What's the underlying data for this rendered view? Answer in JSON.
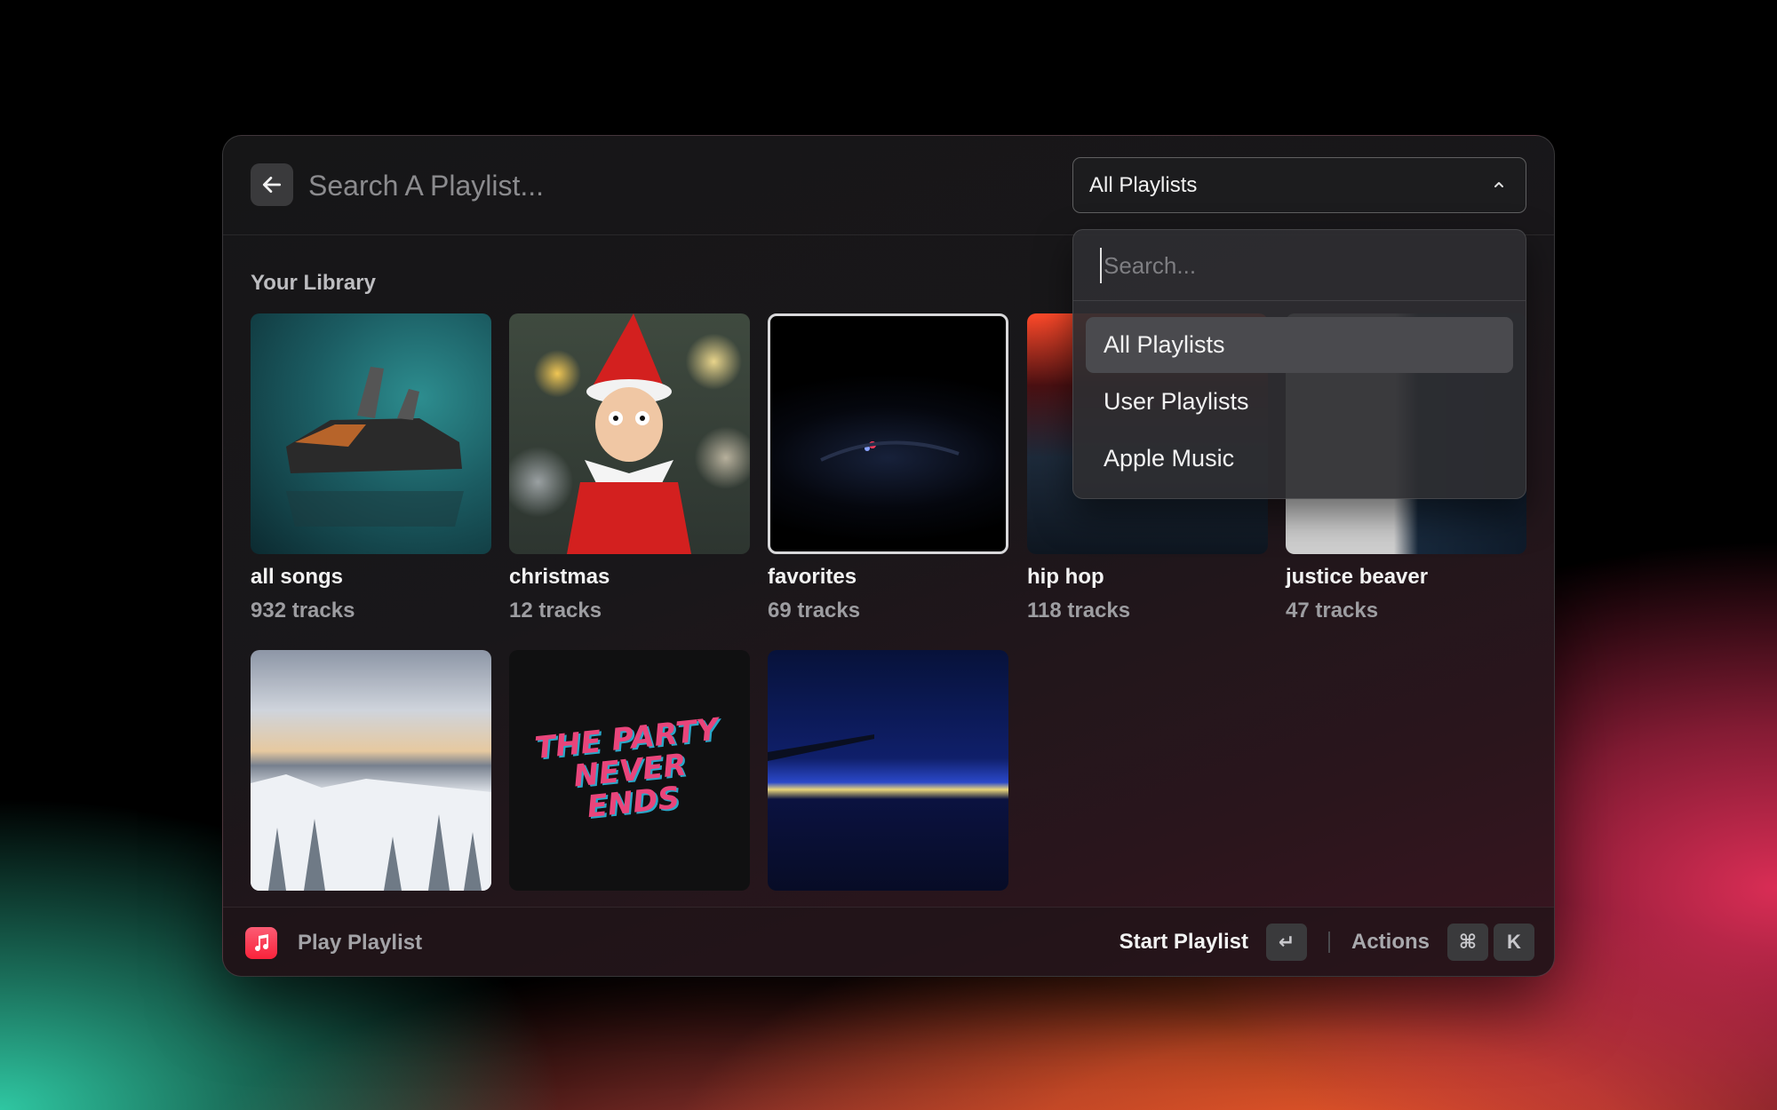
{
  "header": {
    "search_placeholder": "Search A Playlist...",
    "filter_selected": "All Playlists"
  },
  "library": {
    "title": "Your Library",
    "items": [
      {
        "title": "all songs",
        "subtitle": "932 tracks"
      },
      {
        "title": "christmas",
        "subtitle": "12 tracks"
      },
      {
        "title": "favorites",
        "subtitle": "69 tracks"
      },
      {
        "title": "hip hop",
        "subtitle": "118 tracks"
      },
      {
        "title": "justice beaver",
        "subtitle": "47 tracks"
      },
      {
        "title": "",
        "subtitle": ""
      },
      {
        "title": "",
        "subtitle": ""
      },
      {
        "title": "",
        "subtitle": ""
      }
    ],
    "album_art_text": "THE PARTY NEVER ENDS"
  },
  "dropdown": {
    "search_placeholder": "Search...",
    "options": [
      "All Playlists",
      "User Playlists",
      "Apple Music"
    ]
  },
  "footer": {
    "title": "Play Playlist",
    "primary_action": "Start Playlist",
    "primary_key": "↵",
    "secondary_action": "Actions",
    "secondary_keys": [
      "⌘",
      "K"
    ]
  },
  "colors": {
    "accent": "#fa233b",
    "panel_bg": "#161617"
  }
}
